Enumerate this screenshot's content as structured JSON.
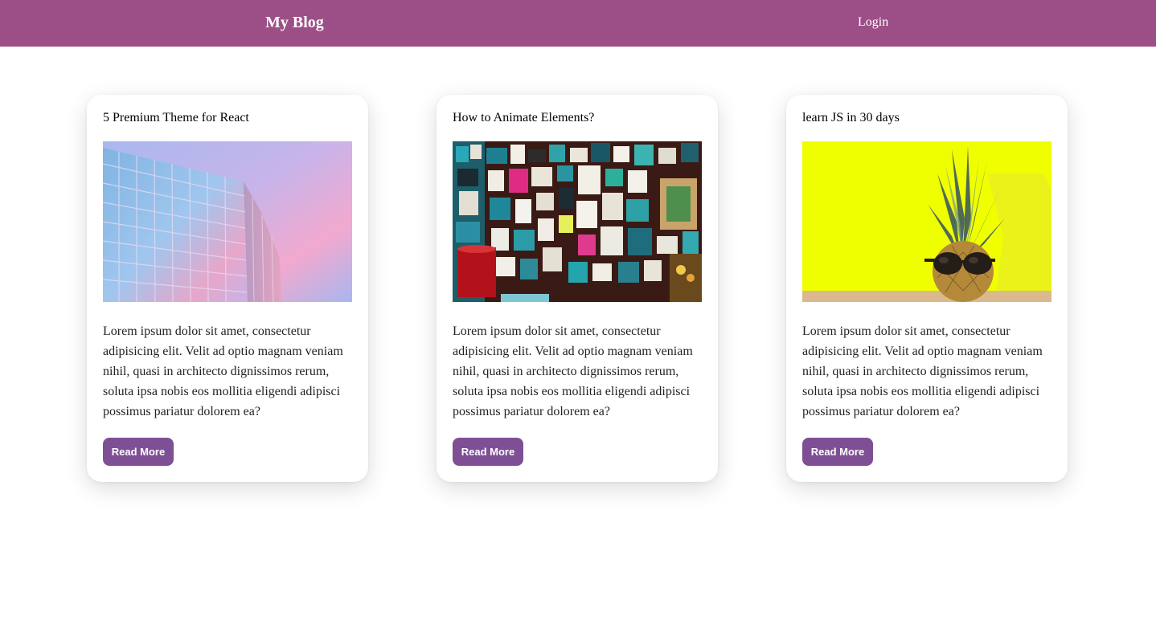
{
  "navbar": {
    "brand": "My Blog",
    "login": "Login",
    "background": "#9c4f87"
  },
  "posts": [
    {
      "title": "5 Premium Theme for React",
      "image": "glass-building-photo",
      "excerpt": "Lorem ipsum dolor sit amet, consectetur adipisicing elit. Velit ad optio magnam veniam nihil, quasi in architecto dignissimos rerum, soluta ipsa nobis eos mollitia eligendi adipisci possimus pariatur dolorem ea?",
      "button_label": "Read More"
    },
    {
      "title": "How to Animate Elements?",
      "image": "poster-wall-photo",
      "excerpt": "Lorem ipsum dolor sit amet, consectetur adipisicing elit. Velit ad optio magnam veniam nihil, quasi in architecto dignissimos rerum, soluta ipsa nobis eos mollitia eligendi adipisci possimus pariatur dolorem ea?",
      "button_label": "Read More"
    },
    {
      "title": "learn JS in 30 days",
      "image": "pineapple-sunglasses-photo",
      "excerpt": "Lorem ipsum dolor sit amet, consectetur adipisicing elit. Velit ad optio magnam veniam nihil, quasi in architecto dignissimos rerum, soluta ipsa nobis eos mollitia eligendi adipisci possimus pariatur dolorem ea?",
      "button_label": "Read More"
    }
  ],
  "colors": {
    "accent": "#7f4f95"
  }
}
